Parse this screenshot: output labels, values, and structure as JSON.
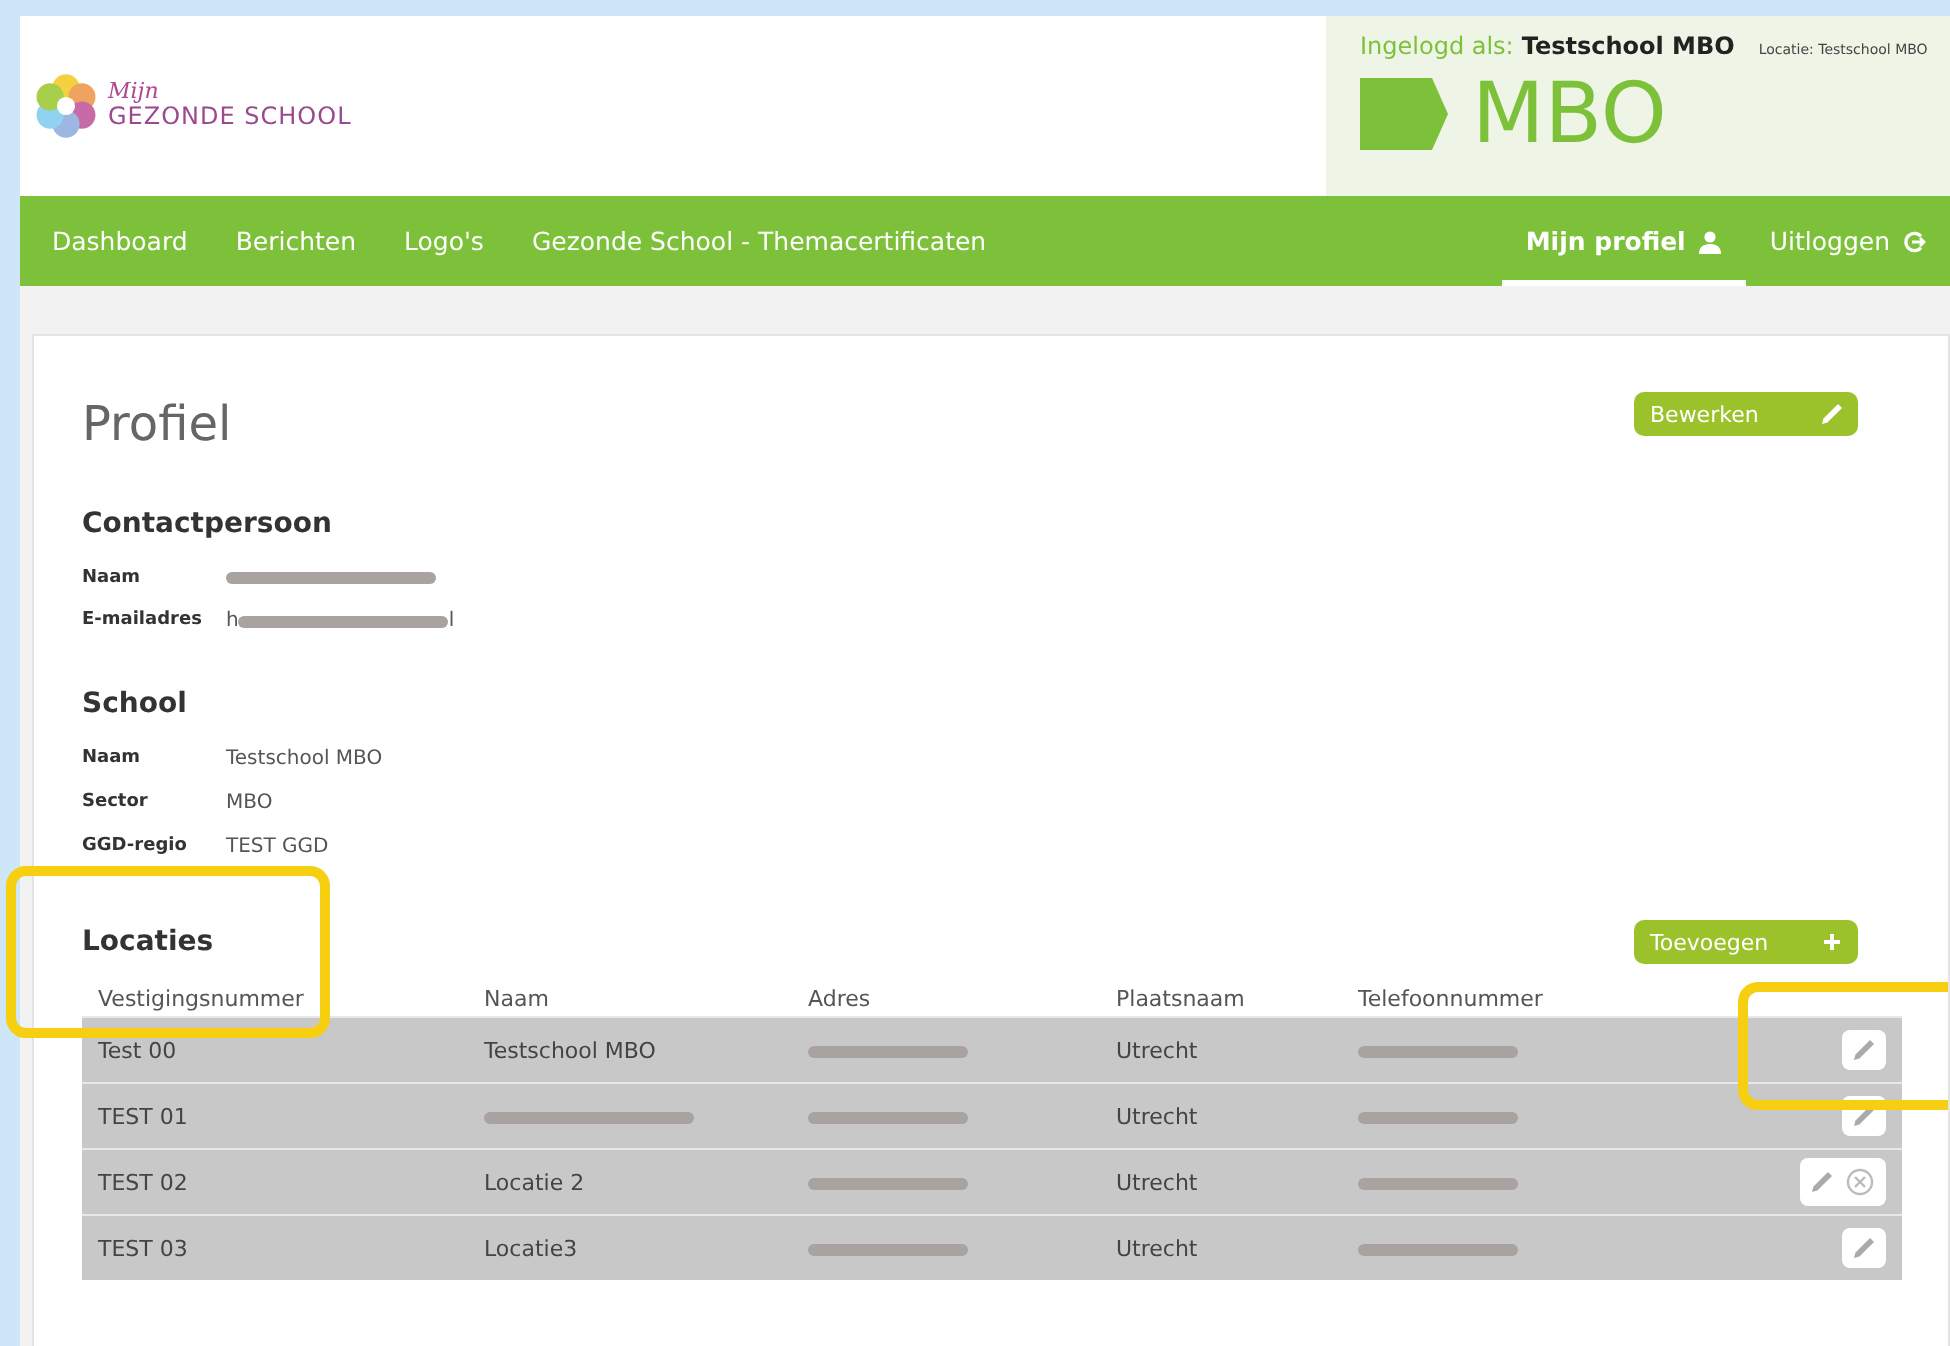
{
  "header": {
    "logo_small": "Mijn",
    "logo_big": "GEZONDE SCHOOL",
    "login_label": "Ingelogd als:",
    "login_name": "Testschool MBO",
    "location": "Locatie: Testschool MBO",
    "sector_badge": "MBO"
  },
  "nav": {
    "items": [
      {
        "label": "Dashboard",
        "selected": false
      },
      {
        "label": "Berichten",
        "selected": false
      },
      {
        "label": "Logo's",
        "selected": false
      },
      {
        "label": "Gezonde School - Themacertificaten",
        "selected": false
      }
    ],
    "right_items": [
      {
        "label": "Mijn profiel",
        "kind": "profile",
        "selected": true
      },
      {
        "label": "Uitloggen",
        "kind": "logout",
        "selected": false
      }
    ]
  },
  "page": {
    "title": "Profiel",
    "edit_button": "Bewerken"
  },
  "contact": {
    "title": "Contactpersoon",
    "fields": [
      {
        "label": "Naam",
        "redacted": true
      },
      {
        "label": "E-mailadres",
        "value_start": "h",
        "value_end": "l",
        "redacted": true
      }
    ]
  },
  "school": {
    "title": "School",
    "fields": [
      {
        "label": "Naam",
        "value": "Testschool MBO"
      },
      {
        "label": "Sector",
        "value": "MBO"
      },
      {
        "label": "GGD-regio",
        "value": "TEST GGD"
      }
    ]
  },
  "locations": {
    "title": "Locaties",
    "highlighted": true,
    "add_button": "Toevoegen",
    "actions_highlighted": true,
    "columns": [
      "Vestigingsnummer",
      "Naam",
      "Adres",
      "Plaatsnaam",
      "Telefoonnummer"
    ],
    "rows": [
      {
        "number": "Test 00",
        "name": "Testschool MBO",
        "name_redacted": false,
        "city": "Utrecht",
        "deletable": false
      },
      {
        "number": "TEST 01",
        "name_redacted": true,
        "city": "Utrecht",
        "deletable": false
      },
      {
        "number": "TEST 02",
        "name": "Locatie 2",
        "name_redacted": false,
        "city": "Utrecht",
        "deletable": true
      },
      {
        "number": "TEST 03",
        "name": "Locatie3",
        "name_redacted": false,
        "city": "Utrecht",
        "deletable": false
      }
    ]
  }
}
